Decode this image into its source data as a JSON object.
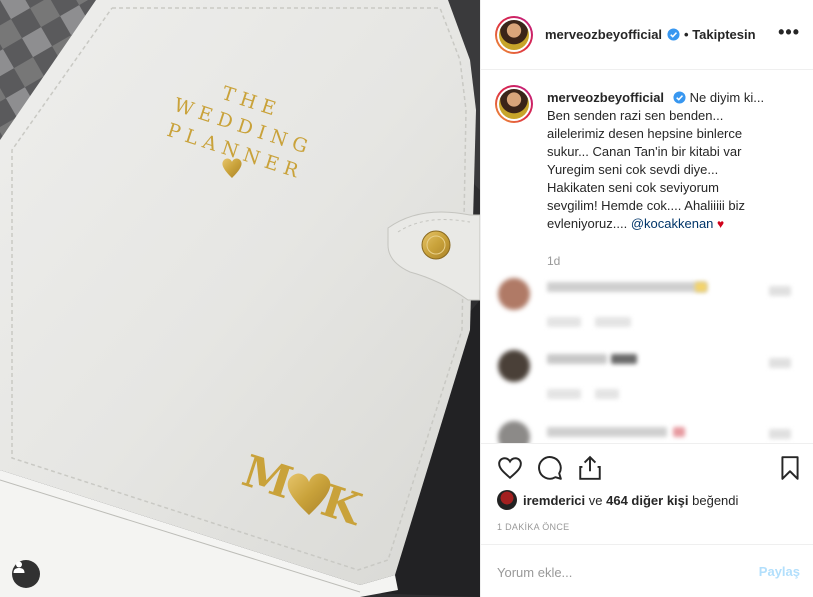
{
  "post": {
    "username": "merveozbeyofficial",
    "follow_state": "• Takiptesin",
    "more_icon": "more-horizontal-icon",
    "caption": {
      "username": "merveozbeyofficial",
      "lines": [
        "Ne diyim ki...",
        "Ben senden razi sen benden...",
        "ailelerimiz desen hepsine binlerce",
        "sukur... Canan Tan'in bir kitabi var",
        "Yuregim seni cok sevdi diye...",
        "Hakikaten seni cok seviyorum",
        "sevgilim! Hemde cok.... Ahaliiiii biz",
        "evleniyoruz.... "
      ],
      "mention": "@kocakkenan",
      "emoji": "♥"
    },
    "time_ago": "1d",
    "photo": {
      "book_title": [
        "THE",
        "WEDDING",
        "PLANNER"
      ],
      "monogram_left": "M",
      "monogram_right": "K"
    },
    "likes": {
      "liker": "iremderici",
      "connector": " ve ",
      "others": "464 diğer kişi",
      "suffix": " beğendi"
    },
    "posted_time": "1 DAKİKA ÖNCE",
    "comment_placeholder": "Yorum ekle...",
    "share_label": "Paylaş"
  },
  "colors": {
    "link": "#003569",
    "verified": "#3897f0",
    "share_disabled": "#b2dffc",
    "gold": "#c9a23a"
  }
}
